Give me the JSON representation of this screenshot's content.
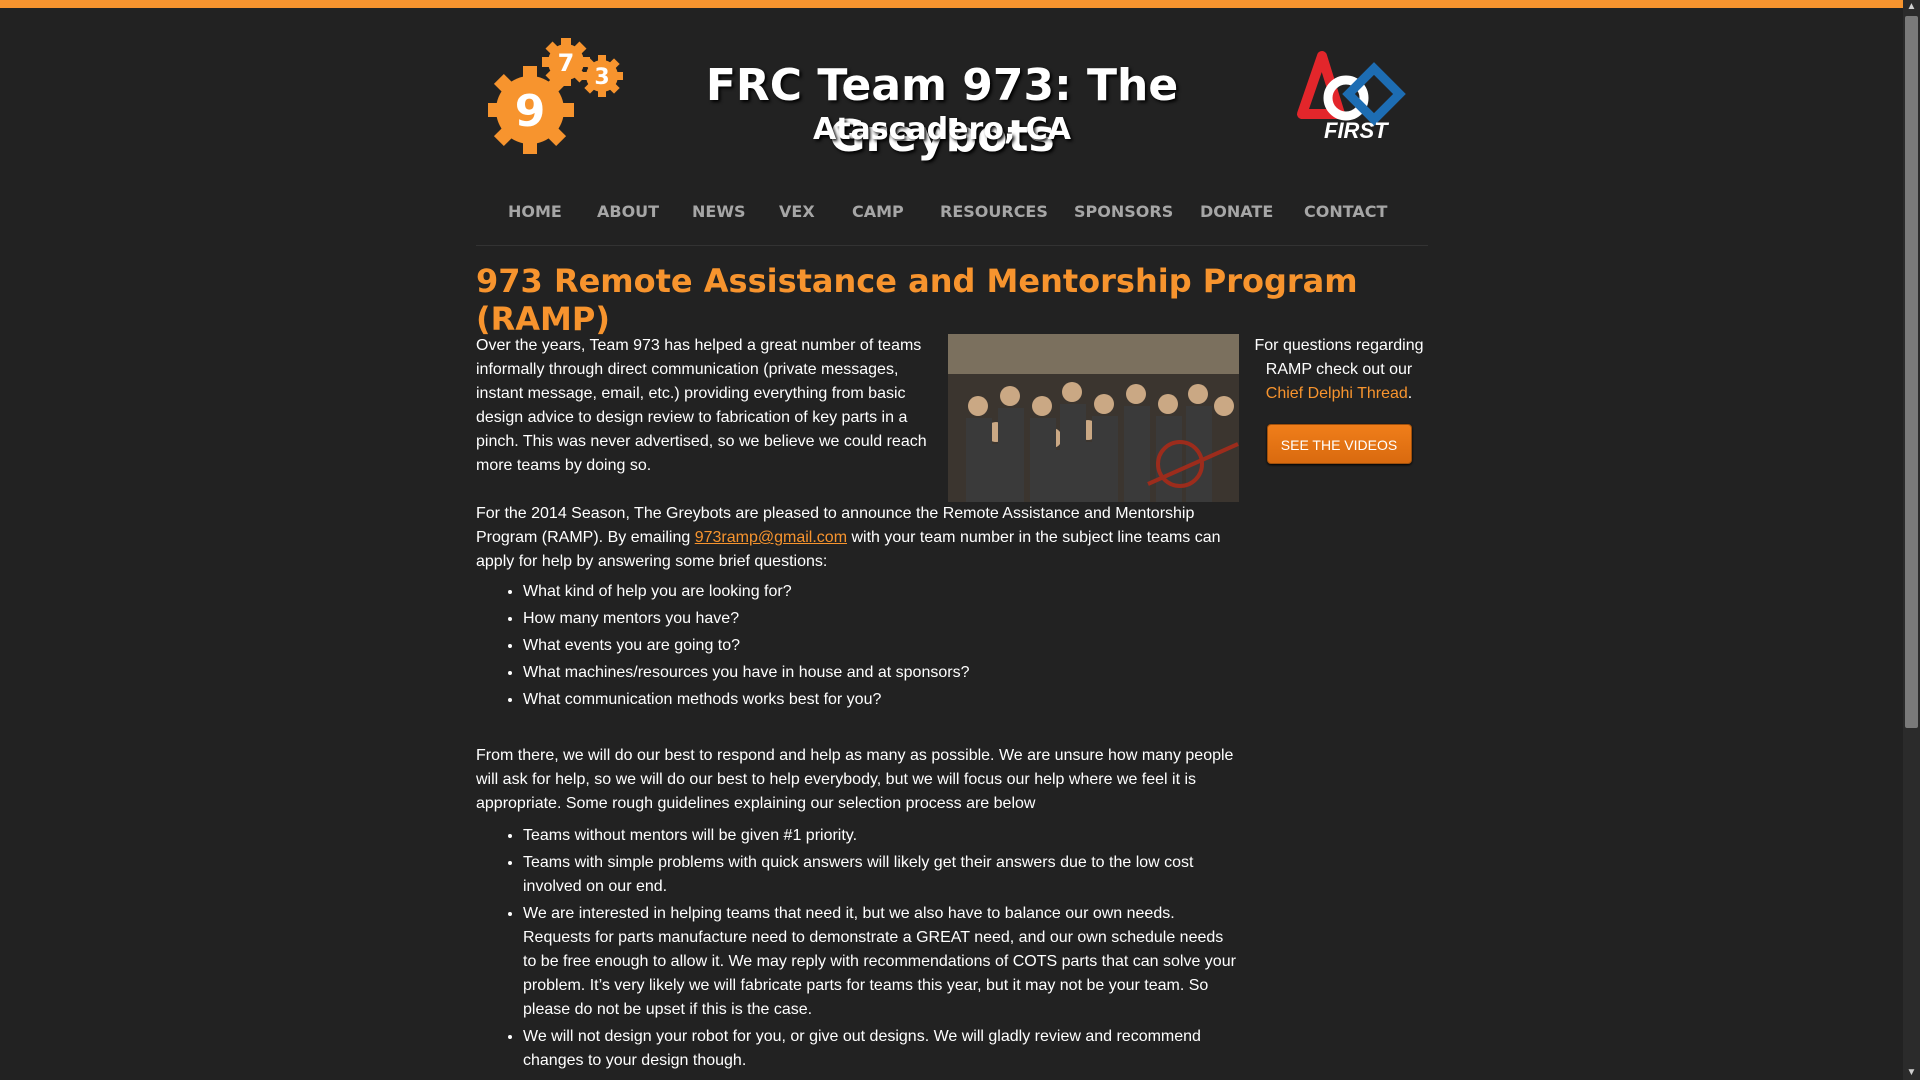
{
  "header": {
    "title": "FRC Team 973: The Greybots",
    "subtitle": "Atascadero, CA",
    "gear_numbers": [
      "9",
      "7",
      "3"
    ],
    "first_logo_text": "FIRST"
  },
  "nav": {
    "items": [
      "HOME",
      "ABOUT",
      "NEWS",
      "VEX",
      "CAMP",
      "RESOURCES",
      "SPONSORS",
      "DONATE",
      "CONTACT"
    ]
  },
  "page": {
    "title": "973 Remote Assistance and Mentorship Program (RAMP)"
  },
  "content": {
    "para1": "Over the years, Team 973 has helped a great number of teams informally through direct communication (private messages, instant message, email, etc.) providing everything from basic design advice to design review to fabrication of key parts in a pinch. This was never advertised, so we believe we could reach more teams by doing so.",
    "para2_before": "For the 2014 Season, The Greybots are pleased to announce the Remote Assistance and Mentorship Program (RAMP). By emailing ",
    "email": "973ramp@gmail.com",
    "para2_after": " with your team number in the subject line teams can apply for help by answering some brief questions:",
    "questions": [
      "What kind of help you are looking for?",
      "How many mentors you have?",
      "What events you are going to?",
      "What machines/resources you have in house and at sponsors?",
      "What communication methods works best for you?"
    ],
    "para3": "From there, we will do our best to respond and help as many as possible. We are unsure how many people will ask for help, so we will do our best to help everybody, but we will focus our help where we feel it is appropriate. Some rough guidelines explaining our selection process are below",
    "guidelines": [
      "Teams without mentors will be given #1 priority.",
      "Teams with simple problems with quick answers will likely get their answers due to the low cost involved on our end.",
      "We are interested in helping teams that need it, but we also have to balance our own needs. Requests for parts manufacture need to demonstrate a GREAT need, and our own schedule needs to be free enough to allow it. We may reply with recommendations of COTS parts that can solve your problem. It’s very likely we will fabricate parts for teams this year, but it may not be your team. So please do not be upset if this is the case.",
      "We will not design your robot for you, or give out designs. We will gladly review and recommend changes to your design though."
    ]
  },
  "sidebar": {
    "text": "For questions regarding RAMP check out our",
    "link": "Chief Delphi Thread",
    "period": ".",
    "button": "SEE THE VIDEOS"
  },
  "colors": {
    "accent": "#f7942e",
    "background": "#222222",
    "nav_text": "#a6a6a6"
  }
}
